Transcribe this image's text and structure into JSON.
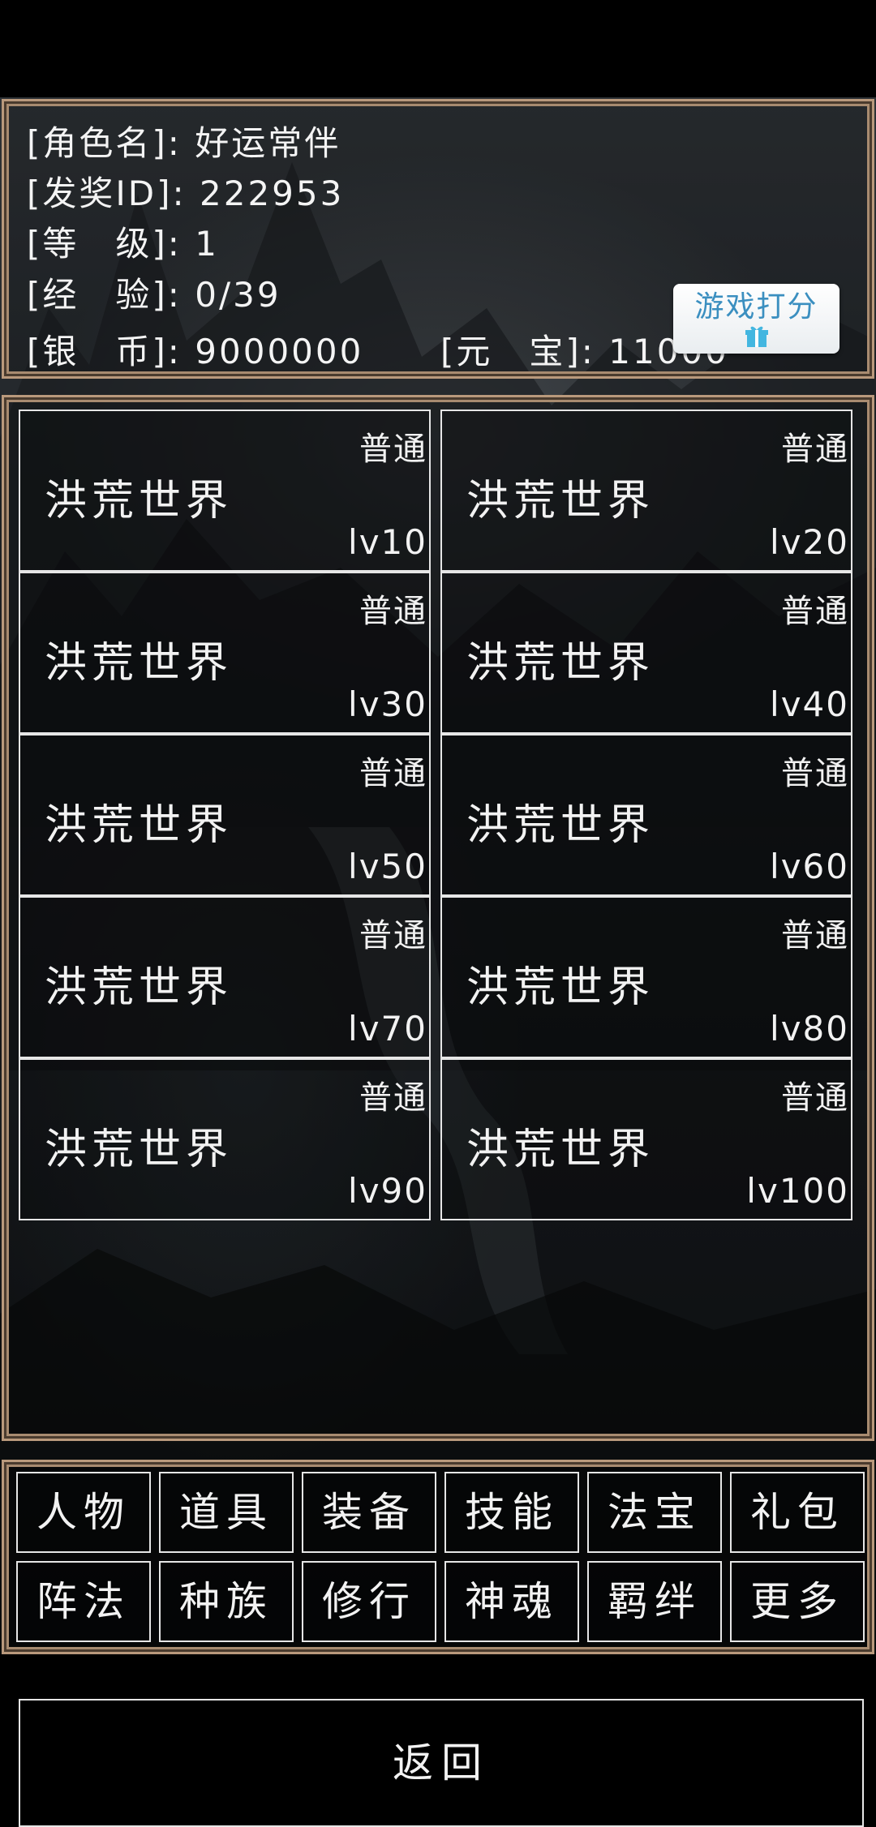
{
  "player": {
    "name_label": "[角色名]: 好运常伴",
    "id_label": "[发奖ID]: 222953",
    "level_label": "[等　级]: 1",
    "exp_label": "[经　验]: 0/39",
    "silver_label": "[银　币]: 9000000",
    "gold_label": "[元　宝]: 11000"
  },
  "rate_button": {
    "label": "游戏打分",
    "icon": "gift-icon"
  },
  "maps": [
    {
      "name": "洪荒世界",
      "difficulty": "普通",
      "level": "lv10"
    },
    {
      "name": "洪荒世界",
      "difficulty": "普通",
      "level": "lv20"
    },
    {
      "name": "洪荒世界",
      "difficulty": "普通",
      "level": "lv30"
    },
    {
      "name": "洪荒世界",
      "difficulty": "普通",
      "level": "lv40"
    },
    {
      "name": "洪荒世界",
      "difficulty": "普通",
      "level": "lv50"
    },
    {
      "name": "洪荒世界",
      "difficulty": "普通",
      "level": "lv60"
    },
    {
      "name": "洪荒世界",
      "difficulty": "普通",
      "level": "lv70"
    },
    {
      "name": "洪荒世界",
      "difficulty": "普通",
      "level": "lv80"
    },
    {
      "name": "洪荒世界",
      "difficulty": "普通",
      "level": "lv90"
    },
    {
      "name": "洪荒世界",
      "difficulty": "普通",
      "level": "lv100"
    }
  ],
  "back_button": {
    "label": "返回"
  },
  "nav": [
    {
      "label": "人物",
      "id": "character"
    },
    {
      "label": "道具",
      "id": "items"
    },
    {
      "label": "装备",
      "id": "equipment"
    },
    {
      "label": "技能",
      "id": "skills"
    },
    {
      "label": "法宝",
      "id": "treasure"
    },
    {
      "label": "礼包",
      "id": "gift-pack"
    },
    {
      "label": "阵法",
      "id": "formation"
    },
    {
      "label": "种族",
      "id": "race"
    },
    {
      "label": "修行",
      "id": "cultivation"
    },
    {
      "label": "神魂",
      "id": "soul"
    },
    {
      "label": "羁绊",
      "id": "bond"
    },
    {
      "label": "更多",
      "id": "more"
    }
  ],
  "colors": {
    "border": "#b9997c",
    "rate_text": "#3b8fc0",
    "gift": "#43b6e0"
  }
}
